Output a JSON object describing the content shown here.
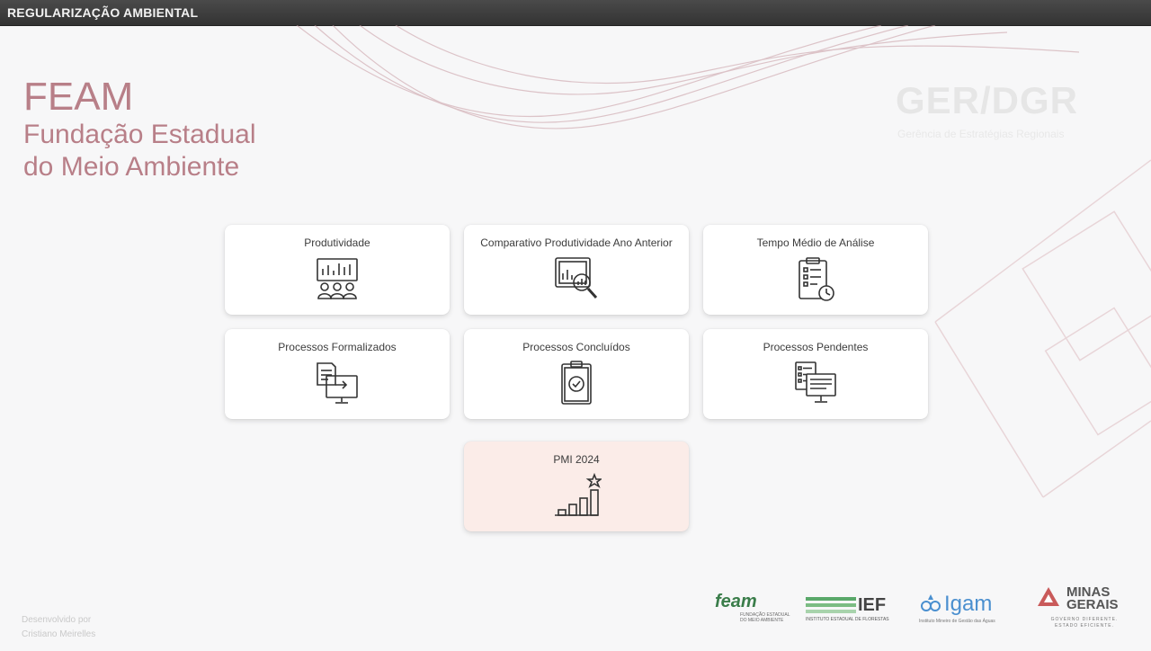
{
  "topbar": {
    "title": "REGULARIZAÇÃO AMBIENTAL"
  },
  "brand": {
    "acronym": "FEAM",
    "line1": "Fundação Estadual",
    "line2": "do Meio Ambiente",
    "color": "#b87f88"
  },
  "watermark": {
    "title": "GER/DGR",
    "subtitle": "Gerência de Estratégias Regionais"
  },
  "cards": [
    {
      "label": "Produtividade",
      "icon": "presentation-audience-icon"
    },
    {
      "label": "Comparativo Produtividade Ano Anterior",
      "icon": "chart-magnifier-icon"
    },
    {
      "label": "Tempo Médio de Análise",
      "icon": "clipboard-clock-icon"
    },
    {
      "label": "Processos Formalizados",
      "icon": "document-computer-icon"
    },
    {
      "label": "Processos Concluídos",
      "icon": "clipboard-check-icon"
    },
    {
      "label": "Processos Pendentes",
      "icon": "list-computer-icon"
    },
    {
      "label": "PMI 2024",
      "icon": "bar-chart-star-icon"
    }
  ],
  "footer": {
    "developed_by": "Desenvolvido por",
    "developer": "Cristiano Meirelles"
  },
  "logos": {
    "feam": {
      "name": "feam",
      "sub1": "FUNDAÇÃO ESTADUAL",
      "sub2": "DO MEIO AMBIENTE"
    },
    "ief": {
      "name": "IEF",
      "sub": "INSTITUTO ESTADUAL DE FLORESTAS"
    },
    "igam": {
      "name": "Igam",
      "sub": "Instituto Mineiro de Gestão das Águas"
    },
    "mg": {
      "name1": "MINAS",
      "name2": "GERAIS",
      "sub1": "GOVERNO DIFERENTE.",
      "sub2": "ESTADO EFICIENTE."
    }
  },
  "colors": {
    "topbar": "#3a3a3a",
    "card": "#ffffff",
    "card_highlight": "#fbece8",
    "accent": "#b87f88"
  }
}
